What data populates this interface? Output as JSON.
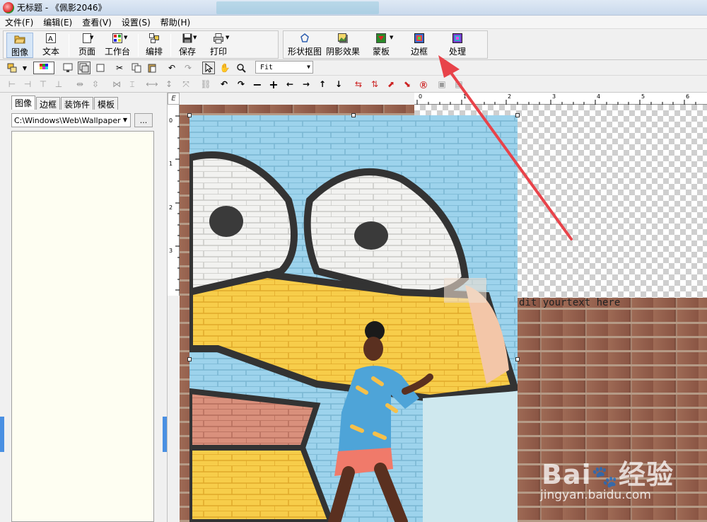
{
  "window": {
    "title": "无标题 - 《佩影2046》"
  },
  "menu": [
    "文件(F)",
    "编辑(E)",
    "查看(V)",
    "设置(S)",
    "帮助(H)"
  ],
  "toolbar": {
    "image": "图像",
    "text": "文本",
    "page": "页面",
    "workbench": "工作台",
    "arrange": "编排",
    "save": "保存",
    "print": "打印",
    "shape_cutout": "形状抠图",
    "shadow": "阴影效果",
    "mask": "蒙板",
    "border": "边框",
    "process": "处理"
  },
  "zoom": {
    "value": "Fit"
  },
  "left_panel": {
    "tabs": [
      "图像",
      "边框",
      "装饰件",
      "模板"
    ],
    "path": "C:\\Windows\\Web\\Wallpaper",
    "browse": "..."
  },
  "rulers": {
    "corner": "E",
    "top": [
      "0",
      "1",
      "2",
      "3",
      "4",
      "5",
      "6"
    ],
    "left": [
      "0",
      "1",
      "2",
      "3"
    ]
  },
  "canvas": {
    "placeholder_text": "dit yourtext here"
  },
  "watermark": {
    "brand": "Bai",
    "brand_cn": "经验",
    "url": "jingyan.baidu.com"
  },
  "colors": {
    "accent": "#e8434a",
    "panel_bg": "#fefef2",
    "selection": "#d6e6f7"
  }
}
